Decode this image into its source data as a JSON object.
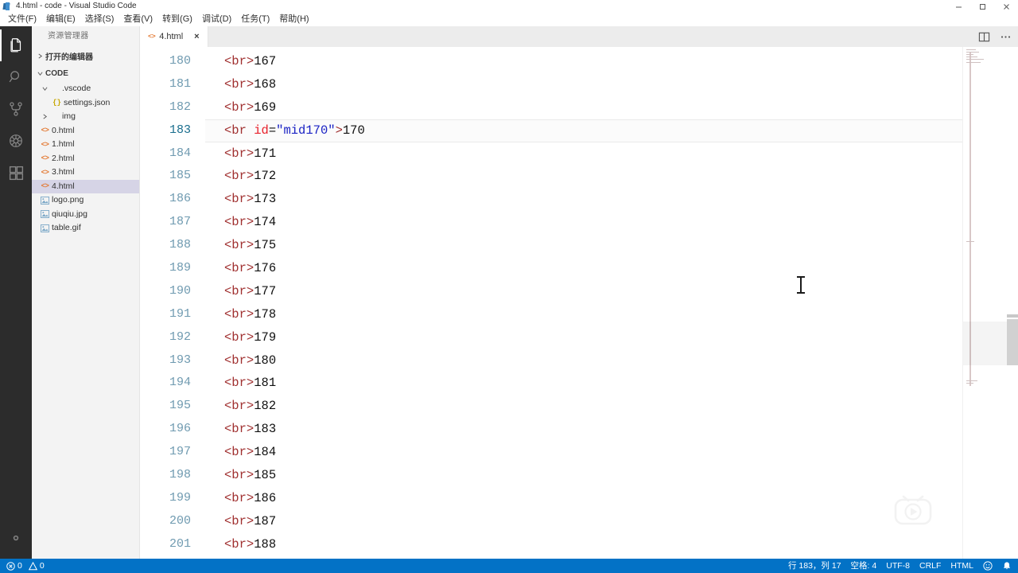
{
  "window": {
    "title": "4.html - code - Visual Studio Code",
    "app_icon": "vscode-icon",
    "controls": {
      "minimize": "minimize-icon",
      "maximize": "maximize-icon",
      "close": "close-icon"
    }
  },
  "menubar": {
    "items": [
      {
        "label": "文件(F)"
      },
      {
        "label": "编辑(E)"
      },
      {
        "label": "选择(S)"
      },
      {
        "label": "查看(V)"
      },
      {
        "label": "转到(G)"
      },
      {
        "label": "调试(D)"
      },
      {
        "label": "任务(T)"
      },
      {
        "label": "帮助(H)"
      }
    ]
  },
  "activitybar": {
    "items": [
      {
        "name": "explorer-icon",
        "label": "资源管理器",
        "active": true
      },
      {
        "name": "search-icon",
        "label": "搜索",
        "active": false
      },
      {
        "name": "source-control-icon",
        "label": "源代码管理",
        "active": false
      },
      {
        "name": "debug-icon",
        "label": "调试",
        "active": false
      },
      {
        "name": "extensions-icon",
        "label": "扩展",
        "active": false
      }
    ],
    "bottom": [
      {
        "name": "gear-icon",
        "label": "管理"
      }
    ]
  },
  "sidebar": {
    "title": "资源管理器",
    "open_editors_label": "打开的编辑器",
    "folder_label": "CODE",
    "tree": [
      {
        "label": ".vscode",
        "icon": "folder-open-icon",
        "indent": 1,
        "twisty": "down",
        "selected": false
      },
      {
        "label": "settings.json",
        "icon": "json-icon",
        "indent": 2,
        "twisty": "none",
        "selected": false
      },
      {
        "label": "img",
        "icon": "folder-icon",
        "indent": 1,
        "twisty": "right",
        "selected": false
      },
      {
        "label": "0.html",
        "icon": "html-icon",
        "indent": 1,
        "twisty": "none",
        "selected": false
      },
      {
        "label": "1.html",
        "icon": "html-icon",
        "indent": 1,
        "twisty": "none",
        "selected": false
      },
      {
        "label": "2.html",
        "icon": "html-icon",
        "indent": 1,
        "twisty": "none",
        "selected": false
      },
      {
        "label": "3.html",
        "icon": "html-icon",
        "indent": 1,
        "twisty": "none",
        "selected": false
      },
      {
        "label": "4.html",
        "icon": "html-icon",
        "indent": 1,
        "twisty": "none",
        "selected": true
      },
      {
        "label": "logo.png",
        "icon": "image-icon",
        "indent": 1,
        "twisty": "none",
        "selected": false
      },
      {
        "label": "qiuqiu.jpg",
        "icon": "image-icon",
        "indent": 1,
        "twisty": "none",
        "selected": false
      },
      {
        "label": "table.gif",
        "icon": "image-icon",
        "indent": 1,
        "twisty": "none",
        "selected": false
      }
    ]
  },
  "tabbar": {
    "tabs": [
      {
        "label": "4.html",
        "icon": "html-icon",
        "close": "×",
        "active": true
      }
    ],
    "actions": [
      {
        "name": "split-editor-icon"
      },
      {
        "name": "more-actions-icon"
      }
    ]
  },
  "editor": {
    "first_line_number": 180,
    "current_line_number": 183,
    "lines": [
      {
        "num": 180,
        "tag_open": "<br>",
        "text": "167",
        "current": false
      },
      {
        "num": 181,
        "tag_open": "<br>",
        "text": "168",
        "current": false
      },
      {
        "num": 182,
        "tag_open": "<br>",
        "text": "169",
        "current": false
      },
      {
        "num": 183,
        "tag_open": "<br",
        "attr": "id",
        "eq": "=",
        "str": "\"mid170\"",
        "tag_close": ">",
        "text": "170",
        "current": true
      },
      {
        "num": 184,
        "tag_open": "<br>",
        "text": "171",
        "current": false
      },
      {
        "num": 185,
        "tag_open": "<br>",
        "text": "172",
        "current": false
      },
      {
        "num": 186,
        "tag_open": "<br>",
        "text": "173",
        "current": false
      },
      {
        "num": 187,
        "tag_open": "<br>",
        "text": "174",
        "current": false
      },
      {
        "num": 188,
        "tag_open": "<br>",
        "text": "175",
        "current": false
      },
      {
        "num": 189,
        "tag_open": "<br>",
        "text": "176",
        "current": false
      },
      {
        "num": 190,
        "tag_open": "<br>",
        "text": "177",
        "current": false
      },
      {
        "num": 191,
        "tag_open": "<br>",
        "text": "178",
        "current": false
      },
      {
        "num": 192,
        "tag_open": "<br>",
        "text": "179",
        "current": false
      },
      {
        "num": 193,
        "tag_open": "<br>",
        "text": "180",
        "current": false
      },
      {
        "num": 194,
        "tag_open": "<br>",
        "text": "181",
        "current": false
      },
      {
        "num": 195,
        "tag_open": "<br>",
        "text": "182",
        "current": false
      },
      {
        "num": 196,
        "tag_open": "<br>",
        "text": "183",
        "current": false
      },
      {
        "num": 197,
        "tag_open": "<br>",
        "text": "184",
        "current": false
      },
      {
        "num": 198,
        "tag_open": "<br>",
        "text": "185",
        "current": false
      },
      {
        "num": 199,
        "tag_open": "<br>",
        "text": "186",
        "current": false
      },
      {
        "num": 200,
        "tag_open": "<br>",
        "text": "187",
        "current": false
      },
      {
        "num": 201,
        "tag_open": "<br>",
        "text": "188",
        "current": false
      }
    ],
    "watermark": "play-logo-watermark"
  },
  "statusbar": {
    "left": [
      {
        "name": "problems-errors",
        "icon": "error-icon",
        "value": "0"
      },
      {
        "name": "problems-warnings",
        "icon": "warning-icon",
        "value": "0"
      }
    ],
    "right": [
      {
        "name": "cursor-position",
        "label": "行 183，列 17"
      },
      {
        "name": "indentation",
        "label": "空格: 4"
      },
      {
        "name": "encoding",
        "label": "UTF-8"
      },
      {
        "name": "eol",
        "label": "CRLF"
      },
      {
        "name": "language-mode",
        "label": "HTML"
      },
      {
        "name": "feedback-icon",
        "label": "☺"
      },
      {
        "name": "notifications-icon",
        "label": "🔔"
      }
    ]
  },
  "colors": {
    "accent": "#0372c6",
    "activitybar_bg": "#2c2c2c",
    "sidebar_bg": "#f3f3f3",
    "tab_inactive_bg": "#ececec",
    "selection": "#d6d4e6",
    "line_number": "#6f9ab0",
    "tag": "#a03030",
    "attribute": "#e8202a",
    "string": "#1a22c4"
  }
}
